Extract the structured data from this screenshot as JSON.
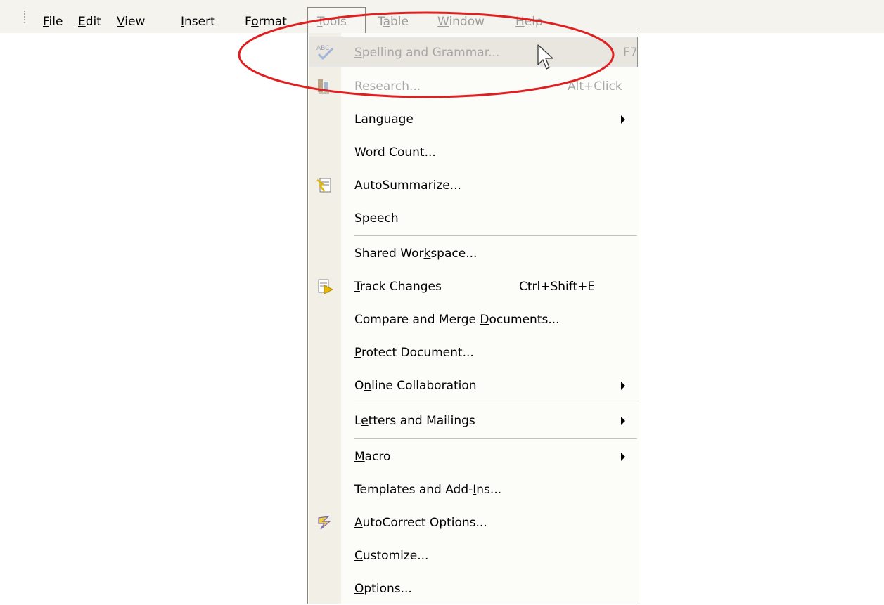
{
  "menubar": {
    "items": [
      {
        "label": "File",
        "u": "F",
        "state": "normal"
      },
      {
        "label": "Edit",
        "u": "E",
        "state": "normal"
      },
      {
        "label": "View",
        "u": "V",
        "state": "normal"
      },
      {
        "label": "Insert",
        "u": "I",
        "state": "normal"
      },
      {
        "label": "Format",
        "u": "o",
        "state": "normal"
      },
      {
        "label": "Tools",
        "u": "T",
        "state": "open"
      },
      {
        "label": "Table",
        "u": "a",
        "state": "dim"
      },
      {
        "label": "Window",
        "u": "W",
        "state": "dim"
      },
      {
        "label": "Help",
        "u": "H",
        "state": "dim"
      }
    ]
  },
  "tools_menu": {
    "items": [
      {
        "label": "Spelling and Grammar...",
        "shortcut": "F7",
        "icon": "spelling-abc-check-icon",
        "disabled": true,
        "hover": true
      },
      {
        "label": "Research...",
        "shortcut": "Alt+Click",
        "icon": "research-books-icon",
        "disabled": true
      },
      {
        "label": "Language",
        "submenu": true
      },
      {
        "label": "Word Count..."
      },
      {
        "label": "AutoSummarize...",
        "icon": "autosummarize-icon"
      },
      {
        "label": "Speech"
      },
      {
        "label": "Shared Workspace...",
        "separator_before": true
      },
      {
        "label": "Track Changes",
        "shortcut": "Ctrl+Shift+E",
        "icon": "track-changes-icon"
      },
      {
        "label": "Compare and Merge Documents..."
      },
      {
        "label": "Protect Document..."
      },
      {
        "label": "Online Collaboration",
        "submenu": true
      },
      {
        "label": "Letters and Mailings",
        "submenu": true,
        "separator_before": true
      },
      {
        "label": "Macro",
        "submenu": true,
        "separator_before": true
      },
      {
        "label": "Templates and Add-Ins..."
      },
      {
        "label": "AutoCorrect Options...",
        "icon": "autocorrect-lightning-icon"
      },
      {
        "label": "Customize..."
      },
      {
        "label": "Options..."
      }
    ]
  },
  "annotation": {
    "shape": "ellipse",
    "color": "#e02020",
    "target": "Spelling and Grammar..."
  },
  "colors": {
    "menubar_bg": "#f4f3ee",
    "menu_bg": "#fcfcf9",
    "gutter": "#f1efe6",
    "disabled_text": "#a8a8a8",
    "highlight_ellipse": "#e02020"
  }
}
